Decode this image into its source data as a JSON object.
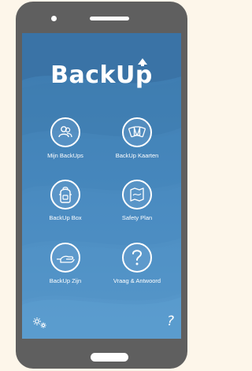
{
  "app": {
    "logo_text": "BackUp"
  },
  "menu": {
    "items": [
      {
        "label": "Mijn BackUps",
        "icon": "people-icon"
      },
      {
        "label": "BackUp Kaarten",
        "icon": "cards-icon"
      },
      {
        "label": "BackUp Box",
        "icon": "backpack-icon"
      },
      {
        "label": "Safety Plan",
        "icon": "map-icon"
      },
      {
        "label": "BackUp Zijn",
        "icon": "helping-hand-icon"
      },
      {
        "label": "Vraag & Antwoord",
        "icon": "question-icon"
      }
    ]
  },
  "footer": {
    "left_icon": "settings-icon",
    "right_icon": "help-icon",
    "right_glyph": "?"
  },
  "colors": {
    "background": "#fdf6ea",
    "phone_body": "#5f5f5f",
    "screen_top": "#3b78ac",
    "screen_bottom": "#5a9bcd",
    "foreground": "#ffffff"
  }
}
